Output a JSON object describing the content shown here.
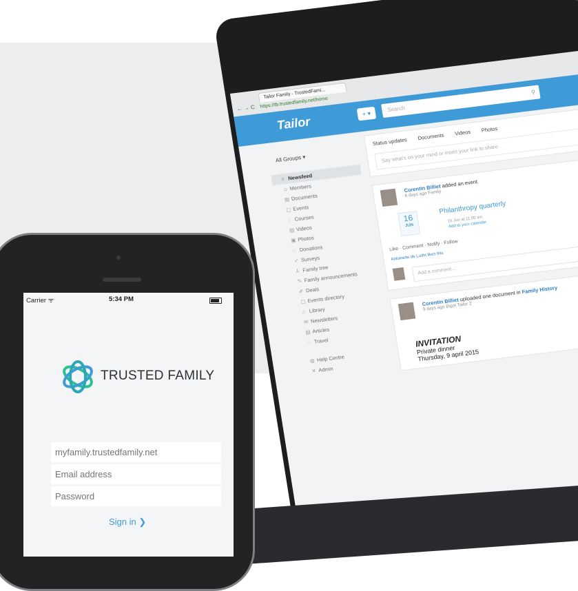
{
  "laptop": {
    "browser": {
      "tab_title": "Tailor Family - TrustedFami...",
      "url": "https://tb.trustedfamily.net/home",
      "nav": "← → C"
    },
    "header": {
      "logo": "Tailor",
      "add_button": "+ ▾",
      "search_placeholder": "Search",
      "search_icon": "magnifier-icon"
    },
    "sidebar": {
      "group_selector": "All Groups ▾",
      "items": [
        {
          "icon": "≡",
          "label": "Newsfeed",
          "active": true
        },
        {
          "icon": "☺",
          "label": "Members"
        },
        {
          "icon": "▤",
          "label": "Documents"
        },
        {
          "icon": "▢",
          "label": "Events"
        },
        {
          "icon": "◌",
          "label": "Courses"
        },
        {
          "icon": "▤",
          "label": "Videos"
        },
        {
          "icon": "▣",
          "label": "Photos"
        },
        {
          "icon": "◌",
          "label": "Donations"
        },
        {
          "icon": "✓",
          "label": "Surveys"
        },
        {
          "icon": "⅄",
          "label": "Family tree"
        },
        {
          "icon": "✎",
          "label": "Family announcements"
        },
        {
          "icon": "✐",
          "label": "Deals"
        },
        {
          "icon": "▢",
          "label": "Events directory"
        },
        {
          "icon": "⌂",
          "label": "Library"
        },
        {
          "icon": "✉",
          "label": "Newsletters"
        },
        {
          "icon": "▤",
          "label": "Articles"
        },
        {
          "icon": "◌",
          "label": "Travel"
        }
      ],
      "footer_items": [
        {
          "icon": "◍",
          "label": "Help Centre"
        },
        {
          "icon": "✕",
          "label": "Admin"
        }
      ]
    },
    "feed": {
      "filters": [
        "Status updates",
        "Documents",
        "Videos",
        "Photos"
      ],
      "compose_placeholder": "Say what's on your mind or insert your link to share",
      "post1": {
        "author": "Corentin Billiet",
        "action": "added an event",
        "time": "6 days ago",
        "group": "Family",
        "event_day": "16",
        "event_month": "JUN",
        "event_title": "Philanthropy quarterly",
        "event_time": "16 Jun at 11:00 am",
        "event_calendar": "Add to your calendar",
        "actions": "Like · Comment · Notify · Follow",
        "likes": "Antoinette de Ludin likes this",
        "comment_placeholder": "Add a comment..."
      },
      "post2": {
        "author": "Corentin Billiet",
        "action": "uploaded one document in",
        "target": "Family History",
        "time": "9 days ago",
        "meta": "Bigot Tailor",
        "count": "2",
        "invitation_title": "INVITATION",
        "invitation_line1": "Private dinner",
        "invitation_line2": "Thursday, 9 april 2015"
      }
    }
  },
  "phone": {
    "status": {
      "carrier": "Carrier ᯤ",
      "time": "5:34 PM"
    },
    "brand": "TRUSTED FAMILY",
    "fields": {
      "domain_placeholder": "myfamily.trustedfamily.net",
      "email_placeholder": "Email address",
      "password_placeholder": "Password"
    },
    "signin": "Sign in ❯",
    "colors": {
      "accent": "#3f9bd8",
      "logo_green": "#2fbf8f"
    }
  }
}
